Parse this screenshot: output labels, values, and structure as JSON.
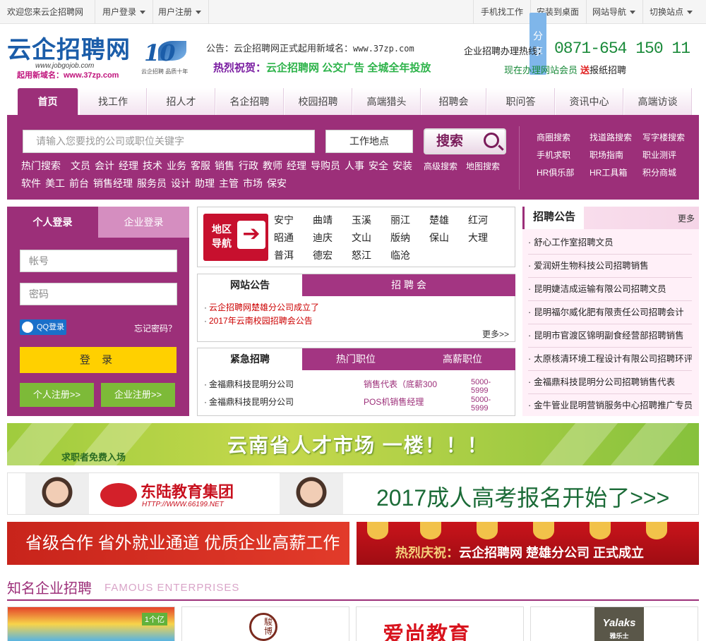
{
  "topbar": {
    "welcome": "欢迎您来云企招聘网",
    "user_login": "用户登录",
    "user_register": "用户注册",
    "mobile_job": "手机找工作",
    "install_desktop": "安装到桌面",
    "site_nav": "网站导航",
    "switch_site": "切换站点"
  },
  "share": "分享",
  "logo": {
    "title": "云企招聘网",
    "url": "www.jobgojob.com",
    "new_domain": "起用新域名：www.37zp.com",
    "anniversary": "10",
    "slogan": "云企招聘 品质十年"
  },
  "notice": {
    "label": "公告：",
    "text": "云企招聘网正式起用新域名：",
    "domain": "www.37zp.com"
  },
  "promo": {
    "a": "热烈祝贺：",
    "b": "云企招聘网 公交广告 全城全年投放"
  },
  "hotline": {
    "label": "企业招聘办理热线：",
    "phone": "0871-654 150 11",
    "vip_text": "现在办理网站会员",
    "send": "送",
    "paper": "报纸招聘"
  },
  "nav": [
    "首页",
    "找工作",
    "招人才",
    "名企招聘",
    "校园招聘",
    "高端猎头",
    "招聘会",
    "职问答",
    "资讯中心",
    "高端访谈"
  ],
  "search": {
    "placeholder": "请输入您要找的公司或职位关键字",
    "location": "工作地点",
    "button": "搜索",
    "hot_label": "热门搜索",
    "hot": [
      "文员",
      "会计",
      "经理",
      "技术",
      "业务",
      "客服",
      "销售",
      "行政",
      "教师",
      "经理",
      "导购员",
      "人事",
      "安全",
      "安装",
      "软件",
      "美工",
      "前台",
      "销售经理",
      "服务员",
      "设计",
      "助理",
      "主管",
      "市场",
      "保安"
    ],
    "advanced": "高级搜索",
    "map": "地图搜索",
    "quick": [
      "商圈搜索",
      "找道路搜索",
      "写字楼搜索",
      "手机求职",
      "职场指南",
      "职业测评",
      "HR俱乐部",
      "HR工具箱",
      "积分商城"
    ]
  },
  "login": {
    "tab_personal": "个人登录",
    "tab_company": "企业登录",
    "account": "帐号",
    "password": "密码",
    "qq": "QQ登录",
    "forgot": "忘记密码？",
    "submit": "登 录",
    "reg_personal": "个人注册>>",
    "reg_company": "企业注册>>"
  },
  "region": {
    "badge_a": "地区",
    "badge_b": "导航",
    "cities": [
      "安宁",
      "曲靖",
      "玉溪",
      "丽江",
      "楚雄",
      "红河",
      "昭通",
      "迪庆",
      "文山",
      "版纳",
      "保山",
      "大理",
      "普洱",
      "德宏",
      "怒江",
      "临沧"
    ]
  },
  "news": {
    "tab_a": "网站公告",
    "tab_b": "招 聘 会",
    "items": [
      "云企招聘网楚雄分公司成立了",
      "2017年云南校园招聘会公告"
    ],
    "more": "更多>>"
  },
  "urgent": {
    "tabs": [
      "紧急招聘",
      "热门职位",
      "高薪职位"
    ],
    "rows": [
      {
        "company": "金福鼎科技昆明分公司",
        "job": "销售代表（底薪300",
        "salary": "5000-5999"
      },
      {
        "company": "金福鼎科技昆明分公司",
        "job": "POS机销售经理",
        "salary": "5000-5999"
      }
    ]
  },
  "zhaopin": {
    "title": "招聘公告",
    "more": "更多",
    "items": [
      "舒心工作室招聘文员",
      "爱润妍生物科技公司招聘销售",
      "昆明婕洁成运输有限公司招聘文员",
      "昆明福尔威化肥有限责任公司招聘会计",
      "昆明市官渡区锦明副食经营部招聘销售",
      "太原核清环境工程设计有限公司招聘环评",
      "金福鼎科技昆明分公司招聘销售代表",
      "金牛管业昆明营销服务中心招聘推广专员"
    ]
  },
  "banners": {
    "b1_title": "云南省人才市场 一楼！！！",
    "b1_sub": "求职者免费入场",
    "b2_company": "东陆教育集团",
    "b2_url": "HTTP://WWW.66199.NET",
    "b2_text": "2017成人高考报名开始了>>>",
    "b3": "省级合作  省外就业通道  优质企业高薪工作",
    "b4_a": "热烈庆祝：",
    "b4_b": "云企招聘网 楚雄分公司 正式成立"
  },
  "famous": {
    "zh": "知名企业招聘",
    "en": "FAMOUS ENTERPRISES",
    "cards": {
      "c1": "1个亿",
      "c2": "駿博",
      "c3": "爱尚教育",
      "c4_en": "Yalaks",
      "c4_zh": "雅乐士"
    }
  }
}
